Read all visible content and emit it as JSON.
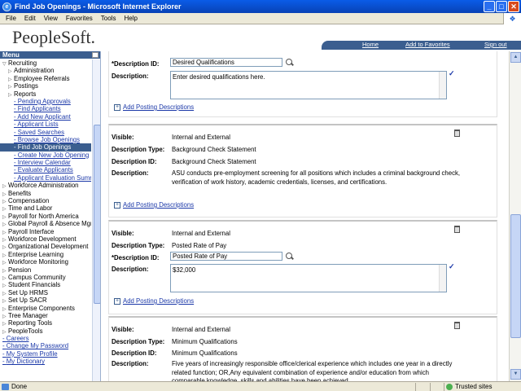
{
  "window": {
    "title": "Find Job Openings - Microsoft Internet Explorer"
  },
  "menubar": [
    "File",
    "Edit",
    "View",
    "Favorites",
    "Tools",
    "Help"
  ],
  "header": {
    "logo": "PeopleSoft.",
    "links": {
      "home": "Home",
      "favorites": "Add to Favorites",
      "signout": "Sign out"
    }
  },
  "menu": {
    "title": "Menu",
    "items": [
      {
        "label": "Recruiting",
        "level": 1,
        "arrow": "▽"
      },
      {
        "label": "Administration",
        "level": 2,
        "arrow": "▷"
      },
      {
        "label": "Employee Referrals",
        "level": 2,
        "arrow": "▷"
      },
      {
        "label": "Postings",
        "level": 2,
        "arrow": "▷"
      },
      {
        "label": "Reports",
        "level": 2,
        "arrow": "▷"
      },
      {
        "label": "Pending Approvals",
        "level": 3,
        "arrow": "-"
      },
      {
        "label": "Find Applicants",
        "level": 3,
        "arrow": "-"
      },
      {
        "label": "Add New Applicant",
        "level": 3,
        "arrow": "-"
      },
      {
        "label": "Applicant Lists",
        "level": 3,
        "arrow": "-"
      },
      {
        "label": "Saved Searches",
        "level": 3,
        "arrow": "-"
      },
      {
        "label": "Browse Job Openings",
        "level": 3,
        "arrow": "-"
      },
      {
        "label": "Find Job Openings",
        "level": 3,
        "arrow": "-",
        "selected": true
      },
      {
        "label": "Create New Job Opening",
        "level": 3,
        "arrow": "-"
      },
      {
        "label": "Interview Calendar",
        "level": 3,
        "arrow": "-"
      },
      {
        "label": "Evaluate Applicants",
        "level": 3,
        "arrow": "-"
      },
      {
        "label": "Applicant Evaluation Summary",
        "level": 3,
        "arrow": "-"
      },
      {
        "label": "Workforce Administration",
        "level": 1,
        "arrow": "▷"
      },
      {
        "label": "Benefits",
        "level": 1,
        "arrow": "▷"
      },
      {
        "label": "Compensation",
        "level": 1,
        "arrow": "▷"
      },
      {
        "label": "Time and Labor",
        "level": 1,
        "arrow": "▷"
      },
      {
        "label": "Payroll for North America",
        "level": 1,
        "arrow": "▷"
      },
      {
        "label": "Global Payroll & Absence Mgmt",
        "level": 1,
        "arrow": "▷"
      },
      {
        "label": "Payroll Interface",
        "level": 1,
        "arrow": "▷"
      },
      {
        "label": "Workforce Development",
        "level": 1,
        "arrow": "▷"
      },
      {
        "label": "Organizational Development",
        "level": 1,
        "arrow": "▷"
      },
      {
        "label": "Enterprise Learning",
        "level": 1,
        "arrow": "▷"
      },
      {
        "label": "Workforce Monitoring",
        "level": 1,
        "arrow": "▷"
      },
      {
        "label": "Pension",
        "level": 1,
        "arrow": "▷"
      },
      {
        "label": "Campus Community",
        "level": 1,
        "arrow": "▷"
      },
      {
        "label": "Student Financials",
        "level": 1,
        "arrow": "▷"
      },
      {
        "label": "Set Up HRMS",
        "level": 1,
        "arrow": "▷"
      },
      {
        "label": "Set Up SACR",
        "level": 1,
        "arrow": "▷"
      },
      {
        "label": "Enterprise Components",
        "level": 1,
        "arrow": "▷"
      },
      {
        "label": "Tree Manager",
        "level": 1,
        "arrow": "▷"
      },
      {
        "label": "Reporting Tools",
        "level": 1,
        "arrow": "▷"
      },
      {
        "label": "PeopleTools",
        "level": 1,
        "arrow": "▷"
      },
      {
        "label": "Careers",
        "level": 0,
        "arrow": "-"
      },
      {
        "label": "Change My Password",
        "level": 0,
        "arrow": "-"
      },
      {
        "label": "My System Profile",
        "level": 0,
        "arrow": "-"
      },
      {
        "label": "My Dictionary",
        "level": 0,
        "arrow": "-"
      }
    ]
  },
  "labels": {
    "description_id_req": "*Description ID:",
    "description": "Description:",
    "visible": "Visible:",
    "description_type": "Description Type:",
    "description_id": "Description ID:",
    "add_posting": "Add Posting Descriptions"
  },
  "sections": [
    {
      "description_id": "Desired Qualifications",
      "description": "Enter desired qualifications here."
    },
    {
      "visible": "Internal and External",
      "type": "Background Check Statement",
      "description_id": "Background Check Statement",
      "description": "ASU conducts pre-employment screening for all positions which includes a criminal background check, verification of work history, academic credentials, licenses, and certifications."
    },
    {
      "visible": "Internal and External",
      "type": "Posted Rate of Pay",
      "description_id": "Posted Rate of Pay",
      "description": "$32,000"
    },
    {
      "visible": "Internal and External",
      "type": "Minimum Qualifications",
      "description_id": "Minimum Qualifications",
      "description": "Five years of increasingly responsible office/clerical experience which includes one year in a directly related function; OR,Any equivalent combination of experience and/or education from which comparable knowledge, skills and abilities have been achieved."
    }
  ],
  "status": {
    "left": "Done",
    "zone": "Trusted sites"
  }
}
